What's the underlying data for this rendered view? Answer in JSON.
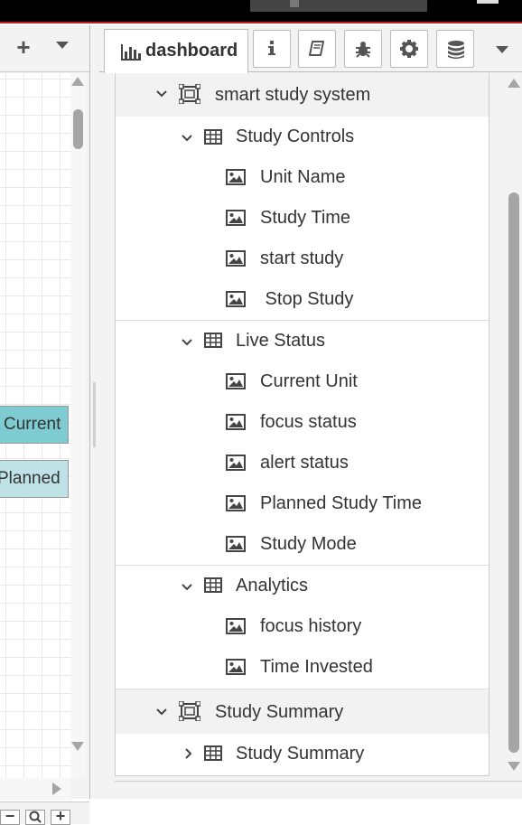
{
  "sidebar": {
    "active_tab": {
      "label": "dashboard",
      "icon": "bar-chart-icon"
    },
    "tab_buttons": [
      {
        "name": "info",
        "icon": "info-icon"
      },
      {
        "name": "help",
        "icon": "book-icon"
      },
      {
        "name": "debug",
        "icon": "bug-icon"
      },
      {
        "name": "config",
        "icon": "gear-icon"
      },
      {
        "name": "context",
        "icon": "database-icon"
      }
    ]
  },
  "tree": {
    "tab_study_system": "smart study system",
    "group_study_controls": "Study Controls",
    "widget_unit_name": "Unit Name",
    "widget_study_time": "Study Time",
    "widget_start_study": "start study",
    "widget_stop_study": " Stop Study",
    "group_live_status": "Live Status",
    "widget_current_unit": "Current Unit",
    "widget_focus_status": "focus status",
    "widget_alert_status": "alert status",
    "widget_planned_study_time": "Planned Study Time",
    "widget_study_mode": "Study Mode",
    "group_analytics": "Analytics",
    "widget_focus_history": "focus history",
    "widget_time_invested": "Time Invested",
    "tab_study_summary": "Study Summary",
    "group_study_summary": "Study Summary"
  },
  "workspace": {
    "node_current": "Current",
    "node_planned": "Planned"
  },
  "colors": {
    "node_current": "#7ecbd1",
    "node_planned": "#bfe2e6",
    "header": "#000000"
  }
}
